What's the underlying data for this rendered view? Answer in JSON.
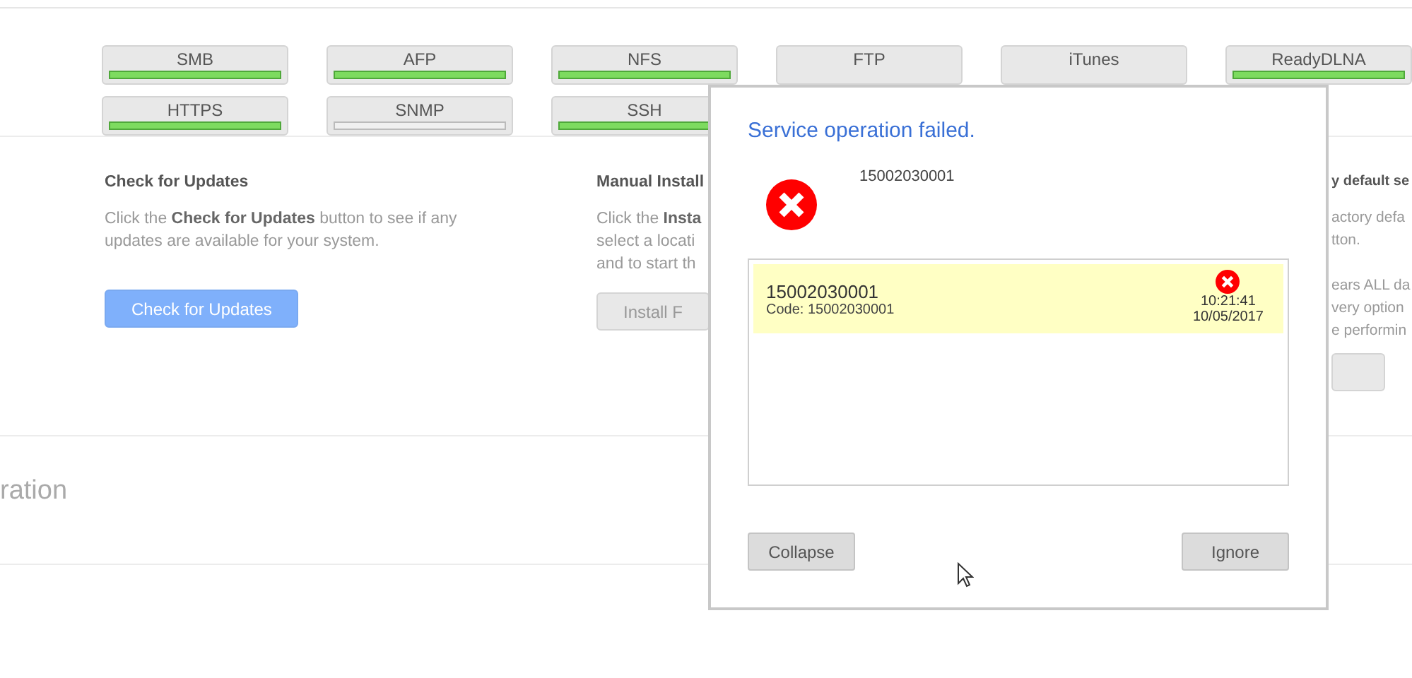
{
  "services": [
    {
      "label": "SMB",
      "on": true
    },
    {
      "label": "AFP",
      "on": true
    },
    {
      "label": "NFS",
      "on": true
    },
    {
      "label": "FTP"
    },
    {
      "label": "iTunes"
    },
    {
      "label": "ReadyDLNA",
      "on": true
    },
    {
      "label": "HTTPS",
      "on": true
    },
    {
      "label": "SNMP",
      "on": false
    },
    {
      "label": "SSH",
      "on": true
    }
  ],
  "update_sections": [
    {
      "heading": "Check for Updates",
      "text": "Click the **Check for Updates** button to see if any updates are available for your system.",
      "button": {
        "label": "Check for Updates",
        "kind": "primary"
      }
    },
    {
      "heading": "Manual Install",
      "text": "Click the **Insta**\nselect a locati\nand to start th",
      "button": {
        "label": "Install F",
        "kind": "secondary"
      }
    },
    {
      "heading": "y default se",
      "text": "actory defa\ntton.\n\nears ALL da\nvery option\ne performin",
      "button": {
        "kind": "secondary"
      }
    }
  ],
  "section_heading": "ration",
  "dialog": {
    "title": "Service operation failed.",
    "message": "15002030001",
    "errors": [
      {
        "title": "15002030001",
        "code": "Code: 15002030001",
        "time": "10:21:41",
        "date": "10/05/2017",
        "selected": true
      }
    ],
    "buttons": [
      "Collapse",
      "Ignore"
    ]
  }
}
